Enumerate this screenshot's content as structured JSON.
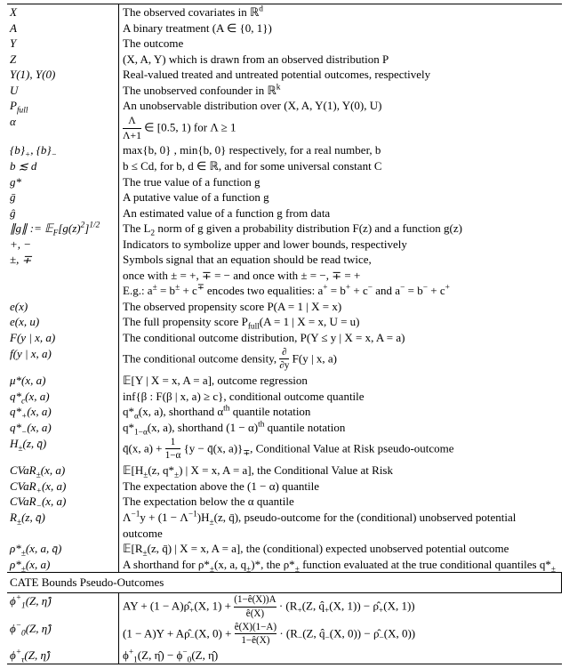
{
  "rows": [
    {
      "sym": "X",
      "desc": "The observed covariates in ℝ<sup>d</sup>"
    },
    {
      "sym": "A",
      "desc": "A binary treatment (A ∈ {0, 1})"
    },
    {
      "sym": "Y",
      "desc": "The outcome"
    },
    {
      "sym": "Z",
      "desc": "(X, A, Y) which is drawn from an observed distribution P"
    },
    {
      "sym": "Y(1), Y(0)",
      "desc": "Real-valued treated and untreated potential outcomes, respectively"
    },
    {
      "sym": "U",
      "desc": "The unobserved confounder in ℝ<sup>k</sup>"
    },
    {
      "sym": "P<sub>full</sub>",
      "desc": "An unobservable distribution over (X, A, Y(1), Y(0), U)"
    },
    {
      "sym": "α",
      "desc": "<span style='display:inline-block;vertical-align:middle;text-align:center;font-size:0.9em;'><span style='display:block;border-bottom:1px solid #000;padding:0 2px;'>Λ</span><span style='display:block;'>Λ+1</span></span> ∈ [0.5, 1) for Λ ≥ 1"
    },
    {
      "sym": "{b}<sub>+</sub>, {b}<sub>−</sub>",
      "desc": "max{b, 0} , min{b, 0} respectively, for a real number, b"
    },
    {
      "sym": "b ≲ d",
      "desc": "b ≤ Cd, for b, d ∈ ℝ, and for some universal constant C"
    },
    {
      "sym": "g*",
      "desc": "The true value of a function g"
    },
    {
      "sym": "ḡ",
      "desc": "A putative value of a function g"
    },
    {
      "sym": "ĝ",
      "desc": "An estimated value of a function g from data"
    },
    {
      "sym": "∥g∥ := 𝔼<sub>F</sub>[g(z)<sup>2</sup>]<sup>1/2</sup>",
      "desc": "The L<sub>2</sub> norm of g given a probability distribution F(z) and a function g(z)"
    },
    {
      "sym": "+, −",
      "desc": "Indicators to symbolize upper and lower bounds, respectively"
    },
    {
      "sym": "±, ∓",
      "desc": "Symbols signal that an equation should be read twice,"
    },
    {
      "sym": "",
      "desc": "once with ± = +, ∓ = − and once with ± = −, ∓ = +"
    },
    {
      "sym": "",
      "desc": "E.g.: a<sup>±</sup> = b<sup>±</sup> + c<sup>∓</sup> encodes two equalities: a<sup>+</sup> = b<sup>+</sup> + c<sup>−</sup> and a<sup>−</sup> = b<sup>−</sup> + c<sup>+</sup>"
    },
    {
      "sym": "e(x)",
      "desc": "The observed propensity score P(A = 1 | X = x)"
    },
    {
      "sym": "e(x, u)",
      "desc": "The full propensity score P<sub>full</sub>(A = 1 | X = x, U = u)"
    },
    {
      "sym": "F(y | x, a)",
      "desc": "The conditional outcome distribution, P(Y ≤ y | X = x, A = a)"
    },
    {
      "sym": "f(y | x, a)",
      "desc": "The conditional outcome density, <span style='display:inline-block;vertical-align:middle;text-align:center;font-size:0.85em;'><span style='display:block;border-bottom:1px solid #000;'>∂</span><span style='display:block;'>∂y</span></span> F(y | x, a)"
    },
    {
      "sym": "μ*(x, a)",
      "desc": "𝔼[Y | X = x, A = a], outcome regression"
    },
    {
      "sym": "q*<sub>c</sub>(x, a)",
      "desc": "inf{β : F(β | x, a) ≥ c}, conditional outcome quantile"
    },
    {
      "sym": "q*<sub>+</sub>(x, a)",
      "desc": "q*<sub>α</sub>(x, a), shorthand α<sup>th</sup> quantile notation"
    },
    {
      "sym": "q*<sub>−</sub>(x, a)",
      "desc": "q*<sub>1−α</sub>(x, a), shorthand (1 − α)<sup>th</sup> quantile notation"
    },
    {
      "sym": "H<sub>±</sub>(z, q̄)",
      "desc": "q̄(x, a) + <span style='display:inline-block;vertical-align:middle;text-align:center;font-size:0.85em;'><span style='display:block;border-bottom:1px solid #000;'>1</span><span style='display:block;'>1−α</span></span> {y − q̄(x, a)}<sub>∓</sub>, Conditional Value at Risk pseudo-outcome"
    },
    {
      "sym": "CVaR<sub>±</sub>(x, a)",
      "desc": "𝔼[H<sub>±</sub>(z, q*<sub>±</sub>) | X = x, A = a], the Conditional Value at Risk"
    },
    {
      "sym": "CVaR<sub>+</sub>(x, a)",
      "desc": "The expectation above the (1 − α) quantile"
    },
    {
      "sym": "CVaR<sub>−</sub>(x, a)",
      "desc": "The expectation below the α quantile"
    },
    {
      "sym": "R<sub>±</sub>(z, q̄)",
      "desc": "Λ<sup>−1</sup>y + (1 − Λ<sup>−1</sup>)H<sub>±</sub>(z, q̄), pseudo-outcome for the (conditional) unobserved potential outcome"
    },
    {
      "sym": "ρ*<sub>±</sub>(x, a, q̄)",
      "desc": "𝔼[R<sub>±</sub>(z, q̄) | X = x, A = a], the (conditional) expected unobserved potential outcome"
    },
    {
      "sym": "ρ*<sub>±</sub>(x, a)",
      "desc": "A shorthand for ρ*<sub>±</sub>(x, a, q<sub>±</sub>)*, the ρ*<sub>±</sub> function evaluated at the true conditional quantiles q*<sub>±</sub>"
    }
  ],
  "section_title": "CATE Bounds Pseudo-Outcomes",
  "cate_rows": [
    {
      "sym": "ϕ<sup>+</sup><sub>1</sub>(Z, η̂)",
      "desc": "AY + (1 − A)ρ̂<sub>+</sub>(X, 1) + <span style='display:inline-block;vertical-align:middle;text-align:center;font-size:0.85em;'><span style='display:block;border-bottom:1px solid #000;'>(1−ê(X))A</span><span style='display:block;'>ê(X)</span></span> · (R<sub>+</sub>(Z, q̂<sub>+</sub>(X, 1)) − ρ̂<sub>+</sub>(X, 1))"
    },
    {
      "sym": "ϕ<sup>−</sup><sub>0</sub>(Z, η̂)",
      "desc": "(1 − A)Y + Aρ̂<sub>−</sub>(X, 0) + <span style='display:inline-block;vertical-align:middle;text-align:center;font-size:0.85em;'><span style='display:block;border-bottom:1px solid #000;'>ê(X)(1−A)</span><span style='display:block;'>1−ê(X)</span></span> · (R<sub>−</sub>(Z, q̂<sub>−</sub>(X, 0)) − ρ̂<sub>−</sub>(X, 0))"
    },
    {
      "sym": "ϕ<sup>+</sup><sub>τ</sub>(Z, η̂)",
      "desc": "ϕ<sup>+</sup><sub>1</sub>(Z, η̂) − ϕ<sup>−</sup><sub>0</sub>(Z, η̂)"
    }
  ]
}
